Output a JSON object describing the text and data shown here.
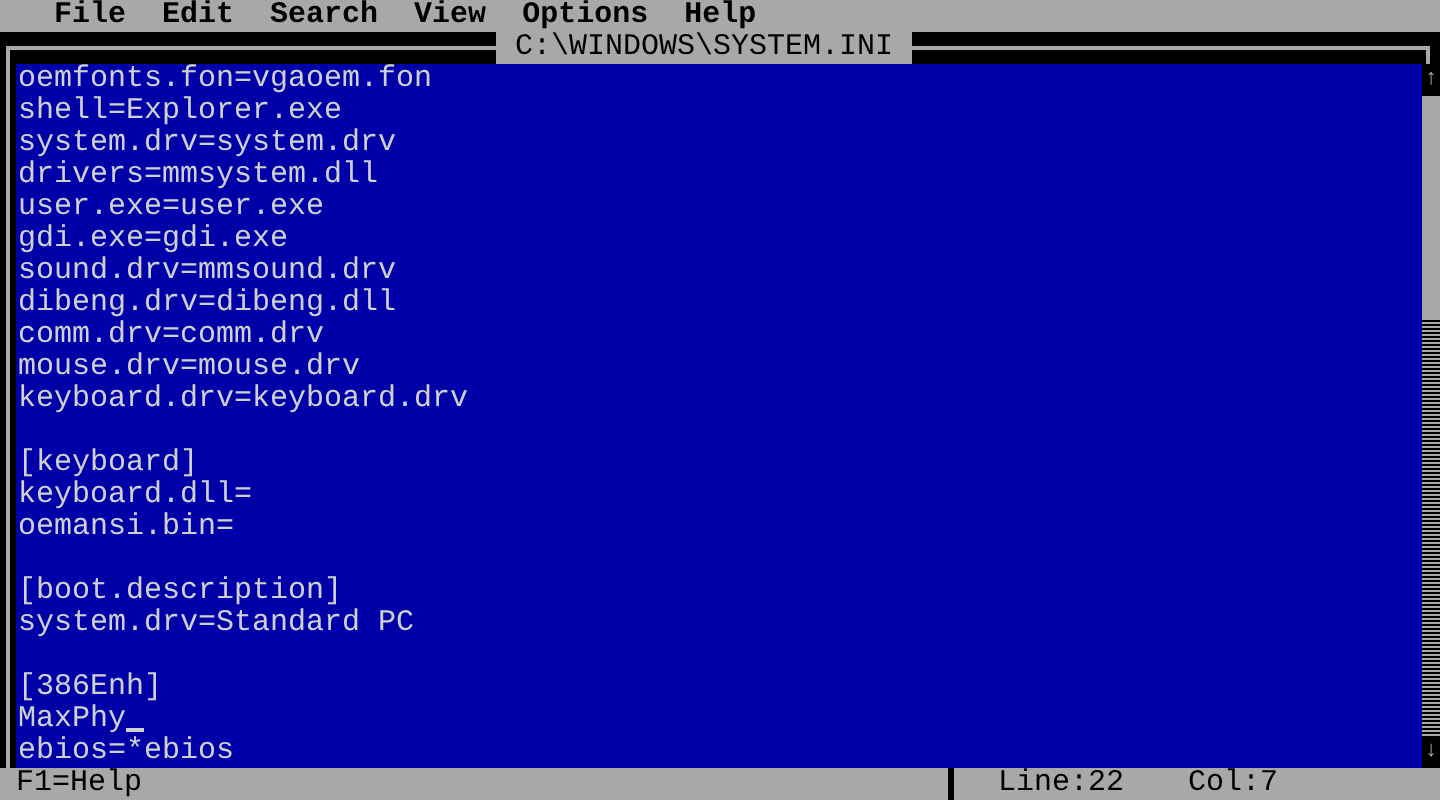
{
  "menu": [
    "File",
    "Edit",
    "Search",
    "View",
    "Options",
    "Help"
  ],
  "window": {
    "title": "C:\\WINDOWS\\SYSTEM.INI"
  },
  "scroll": {
    "up_arrow": "↑",
    "down_arrow": "↓"
  },
  "lines": [
    {
      "text": "oemfonts.fon=vgaoem.fon",
      "cursor": false
    },
    {
      "text": "shell=Explorer.exe",
      "cursor": false
    },
    {
      "text": "system.drv=system.drv",
      "cursor": false
    },
    {
      "text": "drivers=mmsystem.dll",
      "cursor": false
    },
    {
      "text": "user.exe=user.exe",
      "cursor": false
    },
    {
      "text": "gdi.exe=gdi.exe",
      "cursor": false
    },
    {
      "text": "sound.drv=mmsound.drv",
      "cursor": false
    },
    {
      "text": "dibeng.drv=dibeng.dll",
      "cursor": false
    },
    {
      "text": "comm.drv=comm.drv",
      "cursor": false
    },
    {
      "text": "mouse.drv=mouse.drv",
      "cursor": false
    },
    {
      "text": "keyboard.drv=keyboard.drv",
      "cursor": false
    },
    {
      "cursor": false
    },
    {
      "text": "[keyboard]",
      "cursor": false
    },
    {
      "text": "keyboard.dll=",
      "cursor": false
    },
    {
      "text": "oemansi.bin=",
      "cursor": false
    },
    {
      "cursor": false
    },
    {
      "text": "[boot.description]",
      "cursor": false
    },
    {
      "text": "system.drv=Standard PC",
      "cursor": false
    },
    {
      "cursor": false
    },
    {
      "text": "[386Enh]",
      "cursor": false
    },
    {
      "text": "MaxPhy",
      "cursor": true
    },
    {
      "text": "ebios=*ebios",
      "cursor": false
    }
  ],
  "status_bar": {
    "help": "F1=Help",
    "line": "Line:22",
    "col": "Col:7"
  }
}
